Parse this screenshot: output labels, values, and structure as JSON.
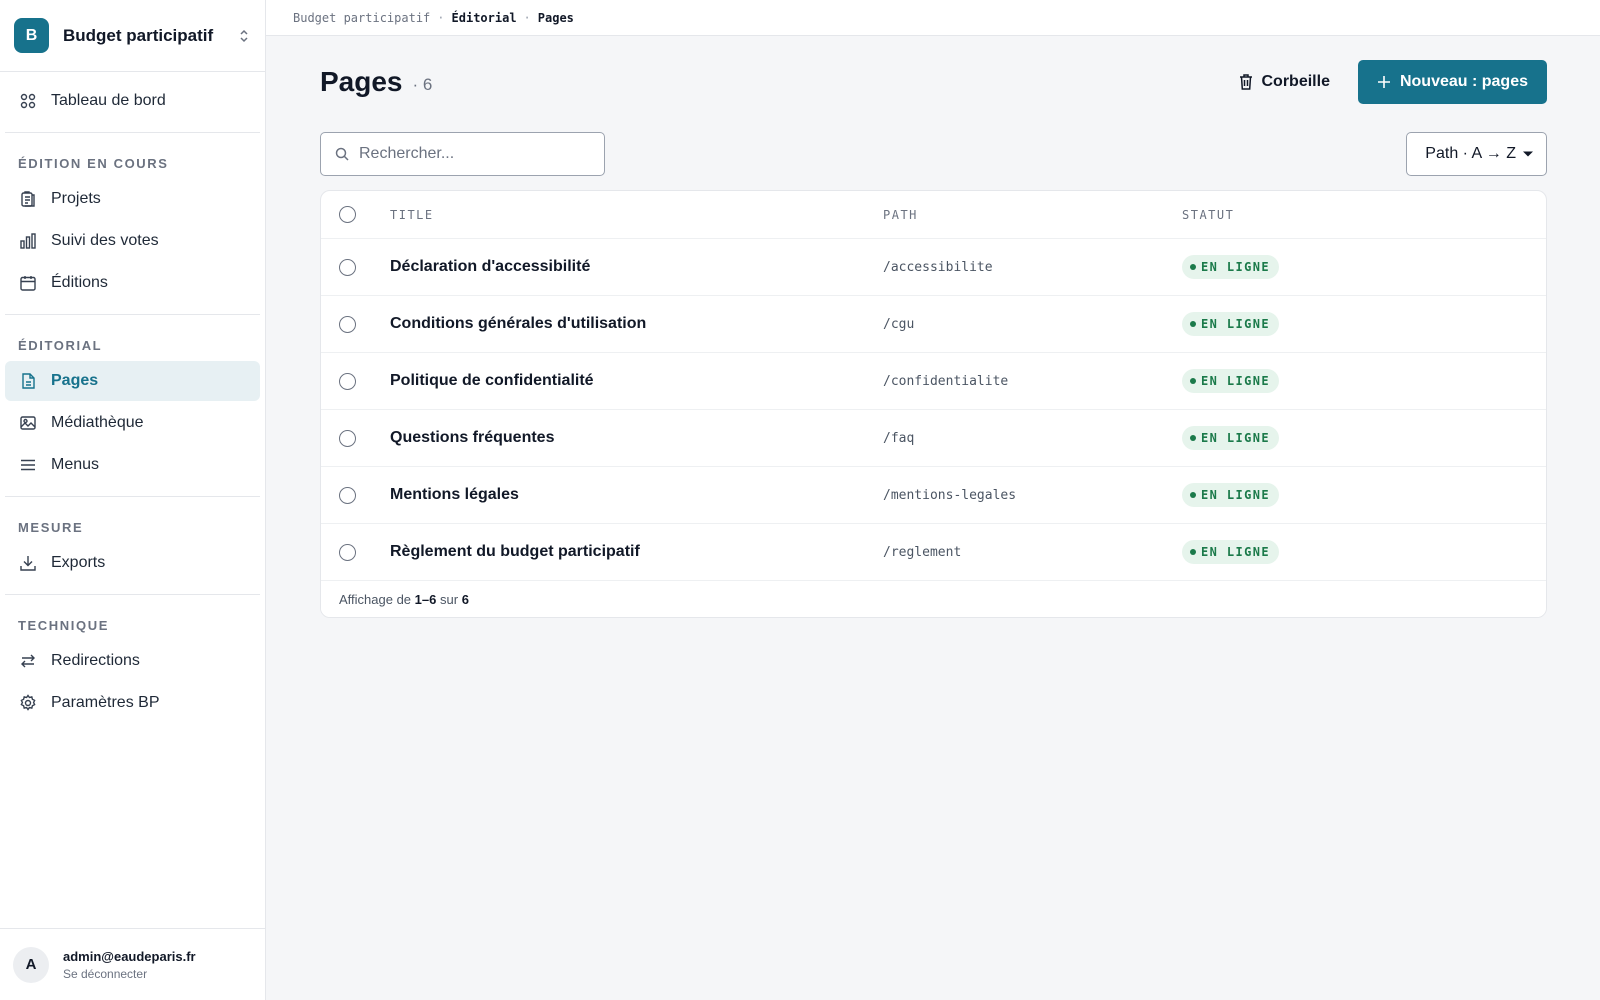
{
  "workspace": {
    "initial": "B",
    "name": "Budget participatif"
  },
  "nav": {
    "dashboard": {
      "label": "Tableau de bord",
      "icon": "grid-icon"
    },
    "groups": [
      {
        "title": "ÉDITION EN COURS",
        "items": [
          {
            "label": "Projets",
            "icon": "clipboard-icon"
          },
          {
            "label": "Suivi des votes",
            "icon": "bar-chart-icon"
          },
          {
            "label": "Éditions",
            "icon": "calendar-icon"
          }
        ]
      },
      {
        "title": "ÉDITORIAL",
        "items": [
          {
            "label": "Pages",
            "icon": "file-icon",
            "active": true
          },
          {
            "label": "Médiathèque",
            "icon": "image-icon"
          },
          {
            "label": "Menus",
            "icon": "menu-icon"
          }
        ]
      },
      {
        "title": "MESURE",
        "items": [
          {
            "label": "Exports",
            "icon": "download-icon"
          }
        ]
      },
      {
        "title": "TECHNIQUE",
        "items": [
          {
            "label": "Redirections",
            "icon": "arrows-icon"
          },
          {
            "label": "Paramètres BP",
            "icon": "gear-icon"
          }
        ]
      }
    ]
  },
  "user": {
    "initial": "A",
    "email": "admin@eaudeparis.fr",
    "logout": "Se déconnecter"
  },
  "breadcrumb": {
    "root": "Budget participatif",
    "section": "Éditorial",
    "current": "Pages"
  },
  "page": {
    "title": "Pages",
    "count": "· 6"
  },
  "actions": {
    "trash": "Corbeille",
    "new": "Nouveau : pages"
  },
  "search": {
    "placeholder": "Rechercher..."
  },
  "sort": {
    "label": "Path · A → Z"
  },
  "table": {
    "columns": {
      "title": "TITLE",
      "path": "PATH",
      "status": "STATUT"
    },
    "rows": [
      {
        "title": "Déclaration d'accessibilité",
        "path": "/accessibilite",
        "status": "EN LIGNE"
      },
      {
        "title": "Conditions générales d'utilisation",
        "path": "/cgu",
        "status": "EN LIGNE"
      },
      {
        "title": "Politique de confidentialité",
        "path": "/confidentialite",
        "status": "EN LIGNE"
      },
      {
        "title": "Questions fréquentes",
        "path": "/faq",
        "status": "EN LIGNE"
      },
      {
        "title": "Mentions légales",
        "path": "/mentions-legales",
        "status": "EN LIGNE"
      },
      {
        "title": "Règlement du budget participatif",
        "path": "/reglement",
        "status": "EN LIGNE"
      }
    ],
    "footer": {
      "prefix": "Affichage de",
      "range": "1–6",
      "middle": "sur",
      "total": "6"
    }
  },
  "colors": {
    "accent": "#17728c",
    "status_online": "#1b7a4a",
    "status_online_bg": "#e6f4ec"
  }
}
